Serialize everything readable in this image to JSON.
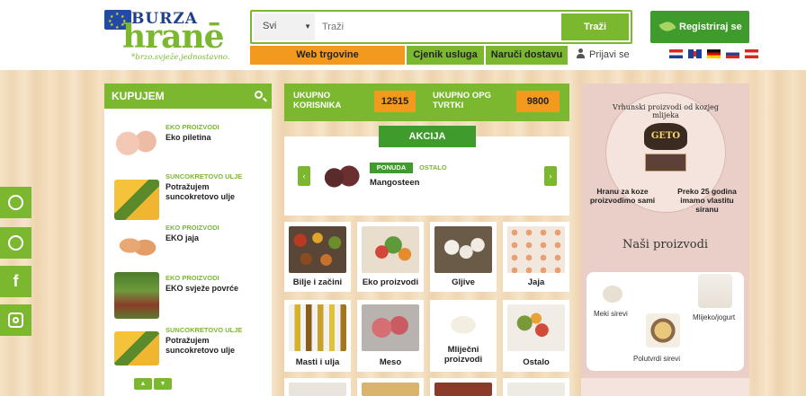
{
  "header": {
    "logo": {
      "burza": "BURZA",
      "hrane": "hranē",
      "tagline": "*brzo.svježe.jednostavno."
    },
    "search": {
      "category": "Svi",
      "placeholder": "Traži",
      "button": "Traži"
    },
    "register": "Registriraj se",
    "nav": {
      "web": "Web trgovine",
      "cjenik": "Cjenik usluga",
      "narudzba": "Naruči dostavu"
    },
    "login": "Prijavi se",
    "languages": [
      "hr",
      "en",
      "de",
      "si",
      "at"
    ]
  },
  "sidebar": {
    "title": "KUPUJEM",
    "items": [
      {
        "category": "EKO PROIZVODI",
        "title": "Eko piletina"
      },
      {
        "category": "SUNCOKRETOVO ULJE",
        "title": "Potražujem suncokretovo ulje"
      },
      {
        "category": "EKO PROIZVODI",
        "title": "EKO jaja"
      },
      {
        "category": "EKO PROIZVODI",
        "title": "EKO svježe povrće"
      },
      {
        "category": "SUNCOKRETOVO ULJE",
        "title": "Potražujem suncokretovo ulje"
      }
    ]
  },
  "stats": {
    "users_label": "UKUPNO KORISNIKA",
    "users_value": "12515",
    "opg_label": "UKUPNO OPG TVRTKI",
    "opg_value": "9800"
  },
  "akcija": {
    "tab": "AKCIJA",
    "badge": "PONUDA",
    "category": "OSTALO",
    "product": "Mangosteen"
  },
  "categories": [
    {
      "label": "Bilje i začini"
    },
    {
      "label": "Eko proizvodi"
    },
    {
      "label": "Gljive"
    },
    {
      "label": "Jaja"
    },
    {
      "label": "Masti i ulja"
    },
    {
      "label": "Meso"
    },
    {
      "label": "Mliječni proizvodi"
    },
    {
      "label": "Ostalo"
    }
  ],
  "promo": {
    "arc": "Vrhunski proizvodi od kozjeg mlijeka",
    "brand": "GETO",
    "left": "Hranu za koze proizvodimo sami",
    "right": "Preko 25 godina imamo vlastitu siranu",
    "products_title": "Naši proizvodi",
    "products": [
      {
        "label": "Meki sirevi"
      },
      {
        "label": "Mlijeko/jogurt"
      },
      {
        "label": "Polutvrdi sirevi"
      }
    ]
  },
  "colors": {
    "green": "#7cb82f",
    "dark_green": "#3f9b2c",
    "orange": "#f39a1e"
  }
}
